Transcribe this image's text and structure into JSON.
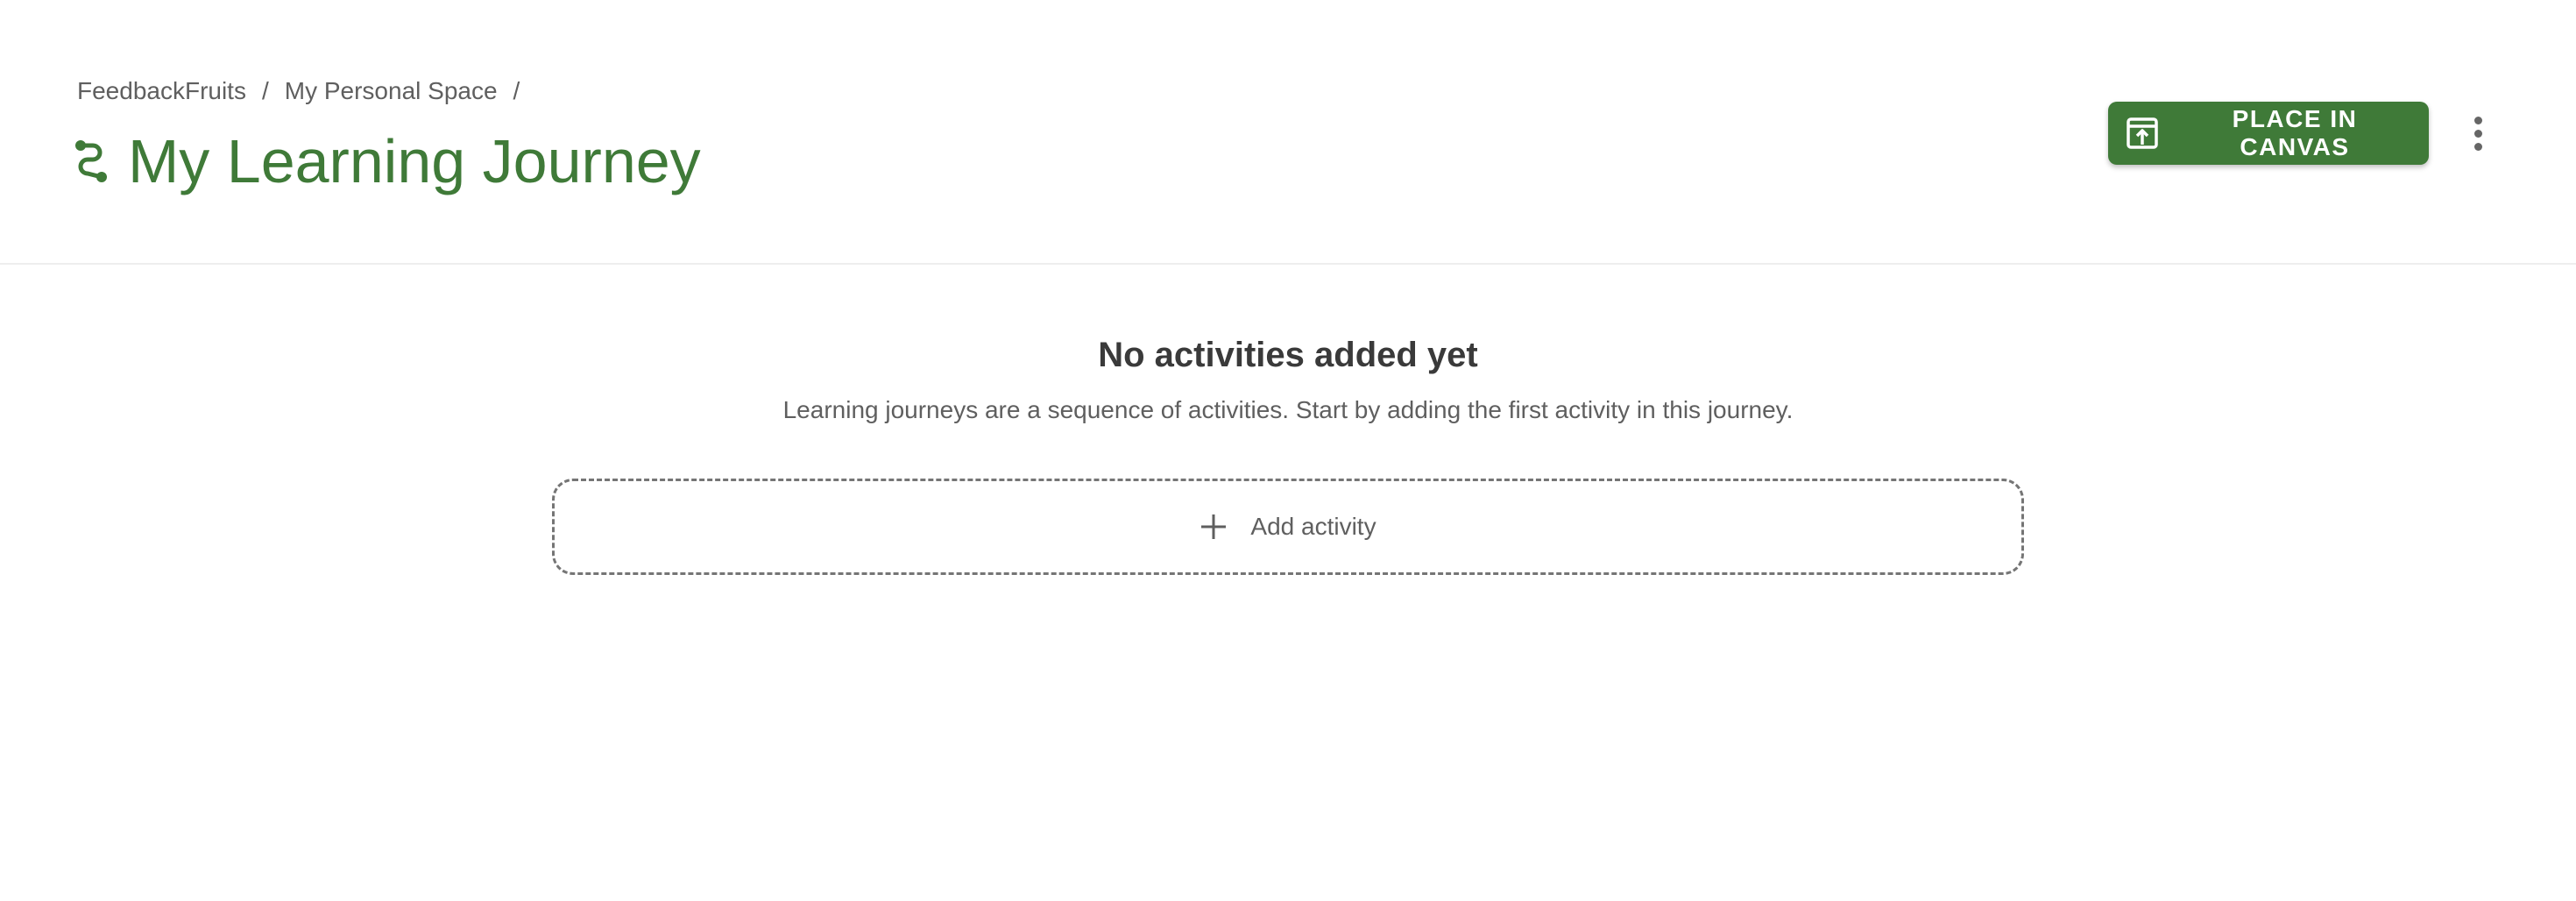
{
  "breadcrumb": {
    "items": [
      "FeedbackFruits",
      "My Personal Space"
    ],
    "separator": "/"
  },
  "header": {
    "title": "My Learning Journey",
    "icon": "learning-journey-icon",
    "primary_action": {
      "label": "PLACE IN CANVAS",
      "icon": "place-in-canvas-icon"
    },
    "more_icon": "more-vertical-icon"
  },
  "empty_state": {
    "title": "No activities added yet",
    "description": "Learning journeys are a sequence of activities. Start by adding the first activity in this journey."
  },
  "add_activity": {
    "label": "Add activity",
    "icon": "plus-icon"
  },
  "colors": {
    "brand_green": "#3f7a38",
    "text_secondary": "#5f5f5f",
    "text_primary": "#3a3a3a"
  }
}
